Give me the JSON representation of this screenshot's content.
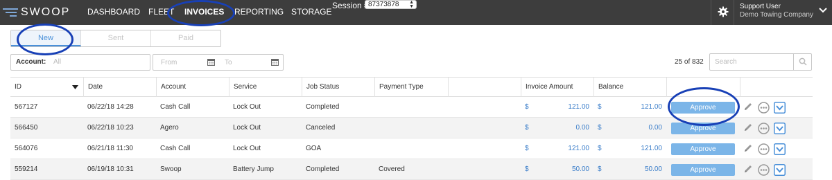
{
  "brand": {
    "name": "SWOOP"
  },
  "nav": {
    "items": [
      "DASHBOARD",
      "FLEET",
      "INVOICES",
      "REPORTING",
      "STORAGE"
    ],
    "active": "INVOICES",
    "session_label": "Session #",
    "session_value": "87373878"
  },
  "user": {
    "name": "Support User",
    "company": "Demo Towing Company"
  },
  "tabs": [
    "New",
    "Sent",
    "Paid"
  ],
  "active_tab": "New",
  "filters": {
    "account_label": "Account:",
    "account_placeholder": "All",
    "from_placeholder": "From",
    "to_placeholder": "To",
    "count": "25 of 832",
    "search_placeholder": "Search"
  },
  "table": {
    "headers": [
      "ID",
      "Date",
      "Account",
      "Service",
      "Job Status",
      "Payment Type",
      "",
      "Invoice Amount",
      "Balance",
      "",
      ""
    ],
    "rows": [
      {
        "id": "567127",
        "date": "06/22/18 14:28",
        "account": "Cash Call",
        "service": "Lock Out",
        "status": "Completed",
        "payment": "",
        "amount": "121.00",
        "balance": "121.00"
      },
      {
        "id": "566450",
        "date": "06/22/18 10:23",
        "account": "Agero",
        "service": "Lock Out",
        "status": "Canceled",
        "payment": "",
        "amount": "0.00",
        "balance": "0.00"
      },
      {
        "id": "564076",
        "date": "06/21/18 11:30",
        "account": "Cash Call",
        "service": "Lock Out",
        "status": "GOA",
        "payment": "",
        "amount": "121.00",
        "balance": "121.00"
      },
      {
        "id": "559214",
        "date": "06/19/18 10:31",
        "account": "Swoop",
        "service": "Battery Jump",
        "status": "Completed",
        "payment": "Covered",
        "amount": "50.00",
        "balance": "50.00"
      }
    ],
    "currency_symbol": "$",
    "approve_label": "Approve"
  },
  "colors": {
    "nav_bg": "#3d3d3d",
    "accent": "#4a90d9",
    "approve": "#7bb5e8",
    "annotation": "#1840b6"
  },
  "icons": [
    "gear-icon",
    "chevron-down-icon",
    "calendar-icon",
    "search-icon",
    "pencil-icon",
    "more-icon",
    "expand-icon"
  ]
}
